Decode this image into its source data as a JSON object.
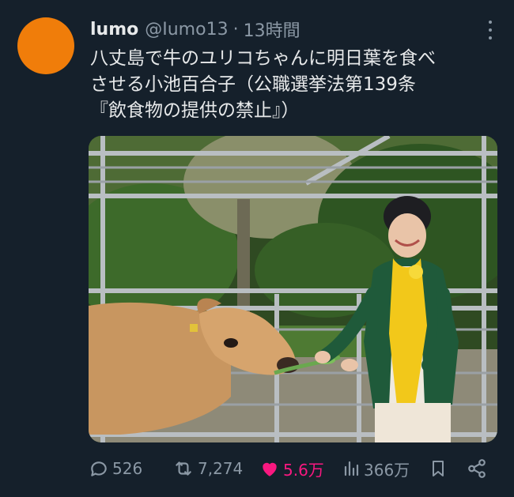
{
  "tweet": {
    "display_name": "lumo",
    "handle": "@Iumo13",
    "separator": "·",
    "time": "13時間",
    "text_lines": [
      "八丈島で牛のユリコちゃんに明日葉を食べ",
      "させる小池百合子（公職選挙法第139条",
      "『飲食物の提供の禁止』）"
    ],
    "avatar_color": "#f07d0a"
  },
  "actions": {
    "reply_count": "526",
    "retweet_count": "7,274",
    "like_count": "5.6万",
    "views_count": "366万",
    "like_color": "#f91880"
  },
  "icons": [
    "more-dots-icon",
    "reply-icon",
    "retweet-icon",
    "heart-icon",
    "views-icon",
    "bookmark-icon",
    "share-icon"
  ]
}
